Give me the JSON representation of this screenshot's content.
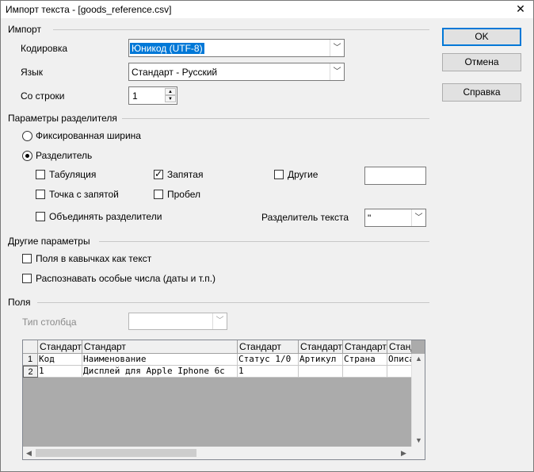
{
  "window": {
    "title": "Импорт текста - [goods_reference.csv]",
    "close_glyph": "✕"
  },
  "import": {
    "section": "Импорт",
    "encoding_label": "Кодировка",
    "encoding_value": "Юникод (UTF-8)",
    "language_label": "Язык",
    "language_value": "Стандарт - Русский",
    "from_row_label": "Со строки",
    "from_row_value": "1"
  },
  "separator": {
    "section": "Параметры разделителя",
    "fixed_width": "Фиксированная ширина",
    "separated": "Разделитель",
    "tab": "Табуляция",
    "comma": "Запятая",
    "other": "Другие",
    "semicolon": "Точка с запятой",
    "space": "Пробел",
    "merge": "Объединять разделители",
    "text_delim_label": "Разделитель текста",
    "text_delim_value": "\"",
    "comma_checked": true
  },
  "other_options": {
    "section": "Другие параметры",
    "quoted_as_text": "Поля в кавычках как текст",
    "detect_special": "Распознавать особые числа (даты и т.п.)"
  },
  "fields": {
    "section": "Поля",
    "column_type_label": "Тип столбца",
    "column_type_value": "",
    "headers": [
      "Стандарт",
      "Стандарт",
      "Стандарт",
      "Стандарт",
      "Стандарт",
      "Станд"
    ],
    "rows": [
      {
        "num": "1",
        "cells": [
          "Код",
          "Наименование",
          "Статус 1/0",
          "Артикул",
          "Страна",
          "Описа"
        ]
      },
      {
        "num": "2",
        "cells": [
          "1",
          "Дисплей для Apple Iphone 6c",
          "1",
          "",
          "",
          ""
        ]
      }
    ]
  },
  "buttons": {
    "ok": "OK",
    "cancel": "Отмена",
    "help": "Справка"
  }
}
